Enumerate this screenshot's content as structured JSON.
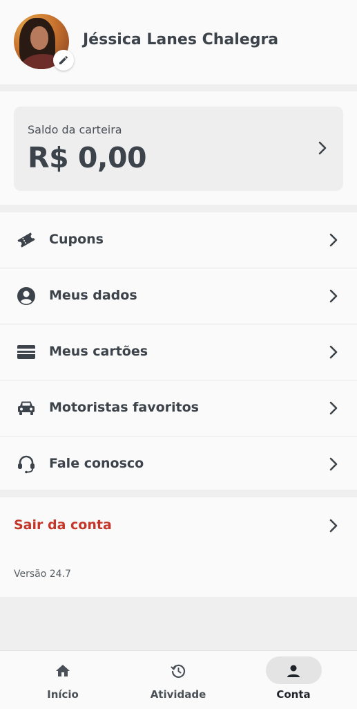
{
  "profile": {
    "name": "Jéssica Lanes Chalegra"
  },
  "wallet": {
    "label": "Saldo da carteira",
    "value": "R$ 0,00"
  },
  "menu": {
    "items": [
      {
        "label": "Cupons",
        "icon": "ticket-icon"
      },
      {
        "label": "Meus dados",
        "icon": "account-circle-icon"
      },
      {
        "label": "Meus cartões",
        "icon": "credit-card-icon"
      },
      {
        "label": "Motoristas favoritos",
        "icon": "car-icon"
      },
      {
        "label": "Fale conosco",
        "icon": "headset-icon"
      }
    ]
  },
  "logout": {
    "label": "Sair da conta"
  },
  "version": "Versão 24.7",
  "nav": {
    "items": [
      {
        "label": "Início",
        "icon": "home-icon",
        "active": false
      },
      {
        "label": "Atividade",
        "icon": "history-icon",
        "active": false
      },
      {
        "label": "Conta",
        "icon": "person-icon",
        "active": true
      }
    ]
  },
  "colors": {
    "logout": "#c4362a",
    "text": "#3c434a",
    "background": "#efefef"
  }
}
